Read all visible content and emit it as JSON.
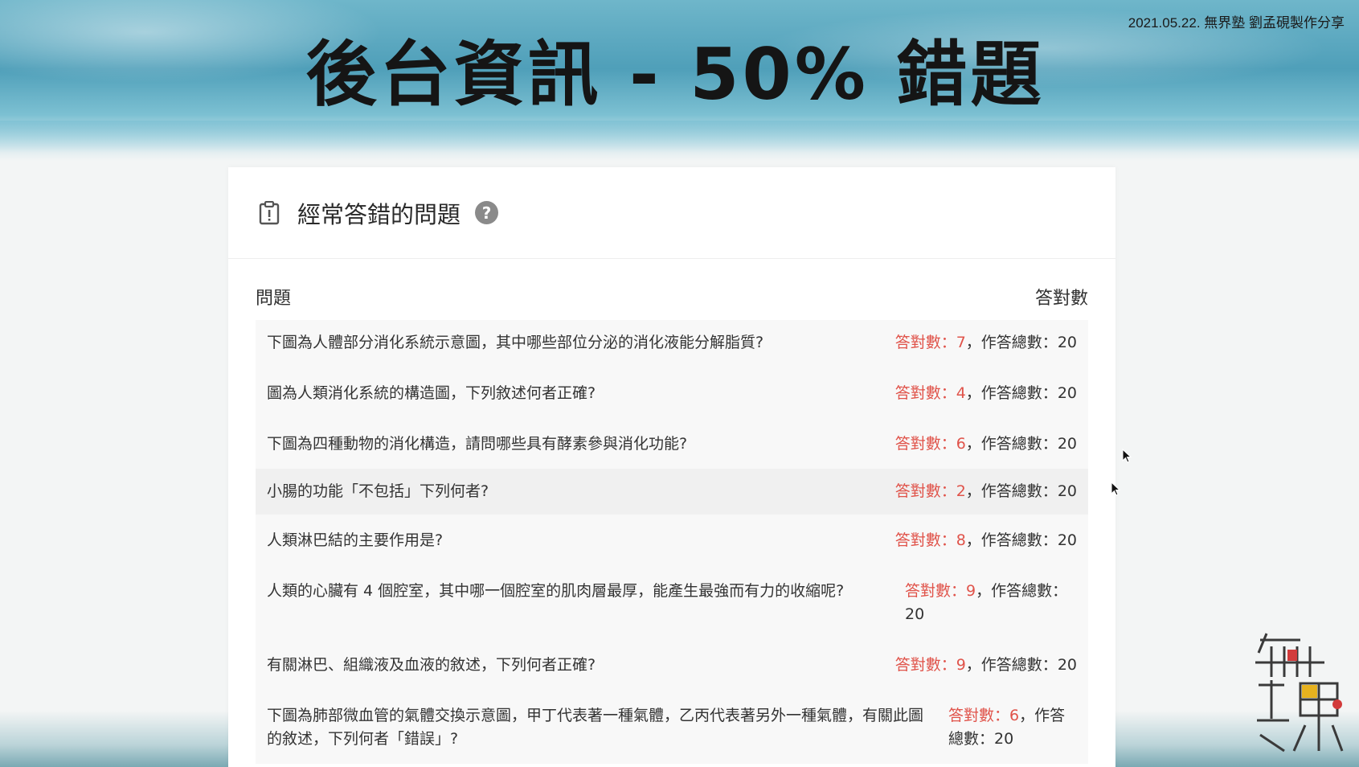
{
  "slide": {
    "title": "後台資訊 - 50% 錯題",
    "credit": "2021.05.22. 無界塾 劉孟硯製作分享"
  },
  "card": {
    "title": "經常答錯的問題",
    "icons": [
      "clipboard-alert-icon",
      "help-circle-icon"
    ],
    "table": {
      "col_question": "問題",
      "col_correct": "答對數",
      "rows": [
        {
          "question": "下圖為人體部分消化系統示意圖，其中哪些部位分泌的消化液能分解脂質?",
          "correct_label": "答對數：",
          "correct_value": "7",
          "total_label": "，作答總數：",
          "total_value": "20"
        },
        {
          "question": "圖為人類消化系統的構造圖，下列敘述何者正確?",
          "correct_label": "答對數：",
          "correct_value": "4",
          "total_label": "，作答總數：",
          "total_value": "20"
        },
        {
          "question": "下圖為四種動物的消化構造，請問哪些具有酵素參與消化功能?",
          "correct_label": "答對數：",
          "correct_value": "6",
          "total_label": "，作答總數：",
          "total_value": "20"
        },
        {
          "question": "小腸的功能「不包括」下列何者?",
          "correct_label": "答對數：",
          "correct_value": "2",
          "total_label": "，作答總數：",
          "total_value": "20"
        },
        {
          "question": "人類淋巴結的主要作用是?",
          "correct_label": "答對數：",
          "correct_value": "8",
          "total_label": "，作答總數：",
          "total_value": "20"
        },
        {
          "question": "人類的心臟有 4 個腔室，其中哪一個腔室的肌肉層最厚，能產生最強而有力的收縮呢?",
          "correct_label": "答對數：",
          "correct_value": "9",
          "total_label": "，作答總數：",
          "total_value": "20"
        },
        {
          "question": "有關淋巴、組織液及血液的敘述，下列何者正確?",
          "correct_label": "答對數：",
          "correct_value": "9",
          "total_label": "，作答總數：",
          "total_value": "20"
        },
        {
          "question": "下圖為肺部微血管的氣體交換示意圖，甲丁代表著一種氣體，乙丙代表著另外一種氣體，有關此圖的敘述，下列何者「錯誤」?",
          "correct_label": "答對數：",
          "correct_value": "6",
          "total_label": "，作答總數：",
          "total_value": "20"
        }
      ]
    }
  },
  "colors": {
    "correct_count": "#e0534a",
    "text": "#333333",
    "row_bg": "#f8f8f8",
    "banner": "#4f9fb9"
  },
  "logo": {
    "icon": "wujie-logo"
  }
}
